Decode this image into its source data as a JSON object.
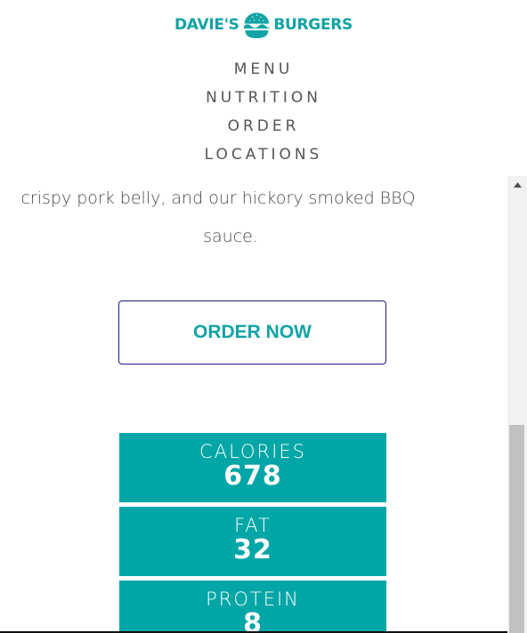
{
  "brand": {
    "left_word": "DAVIE'S",
    "right_word": "BURGERS",
    "color": "#12a3a6"
  },
  "nav": {
    "items": [
      "MENU",
      "NUTRITION",
      "ORDER",
      "LOCATIONS"
    ]
  },
  "description": {
    "line1": "crispy pork belly, and our hickory smoked BBQ",
    "line2": "sauce."
  },
  "order_button": {
    "label": "ORDER NOW"
  },
  "nutrition": [
    {
      "label": "CALORIES",
      "value": "678"
    },
    {
      "label": "FAT",
      "value": "32"
    },
    {
      "label": "PROTEIN",
      "value": "8"
    }
  ],
  "colors": {
    "accent": "#03a6a6",
    "button_border": "#1a1a80"
  }
}
